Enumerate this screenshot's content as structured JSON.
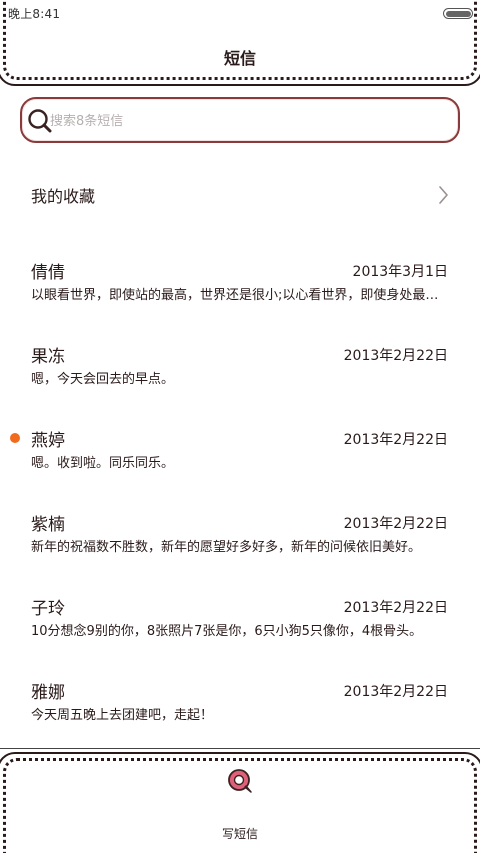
{
  "status_bar": {
    "time": "晚上8:41"
  },
  "header": {
    "title": "短信"
  },
  "search": {
    "placeholder": "搜索8条短信"
  },
  "favorites": {
    "label": "我的收藏"
  },
  "conversations": [
    {
      "name": "倩倩",
      "date": "2013年3月1日",
      "preview": "以眼看世界，即使站的最高，世界还是很小;以心看世界，即使身处最低，世界也是很大。",
      "unread": false
    },
    {
      "name": "果冻",
      "date": "2013年2月22日",
      "preview": "嗯，今天会回去的早点。",
      "unread": false
    },
    {
      "name": "燕婷",
      "date": "2013年2月22日",
      "preview": "嗯。收到啦。同乐同乐。",
      "unread": true
    },
    {
      "name": "紫楠",
      "date": "2013年2月22日",
      "preview": "新年的祝福数不胜数，新年的愿望好多好多，新年的问候依旧美好。",
      "unread": false
    },
    {
      "name": "子玲",
      "date": "2013年2月22日",
      "preview": "10分想念9别的你，8张照片7张是你，6只小狗5只像你，4根骨头。",
      "unread": false
    },
    {
      "name": "雅娜",
      "date": "2013年2月22日",
      "preview": "今天周五晚上去团建吧，走起！",
      "unread": false
    }
  ],
  "bottom_bar": {
    "compose_label": "写短信"
  },
  "colors": {
    "accent": "#8a3a3a",
    "unread_dot": "#f26b1d",
    "compose_icon": "#e0607a"
  }
}
